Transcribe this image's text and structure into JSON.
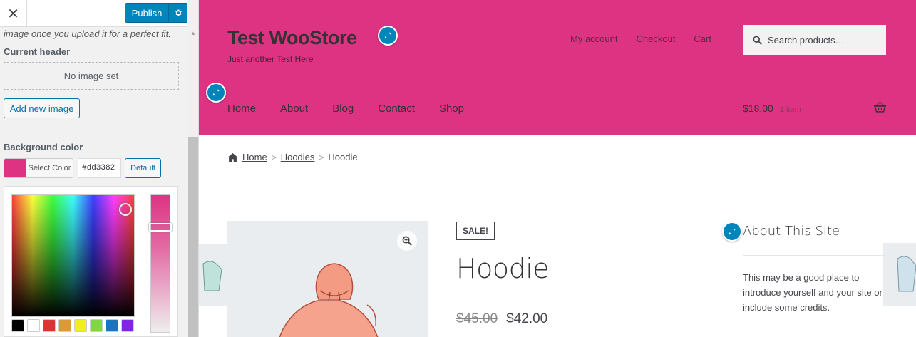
{
  "sidebar": {
    "close_label": "✕",
    "publish_label": "Publish",
    "description": "image once you upload it for a perfect fit.",
    "current_header_label": "Current header",
    "no_image_text": "No image set",
    "add_image_label": "Add new image",
    "background_color_label": "Background color",
    "select_color_label": "Select Color",
    "hex_value": "#dd3382",
    "default_label": "Default",
    "palette": [
      "#000000",
      "#ffffff",
      "#dd3333",
      "#dd9933",
      "#eeee22",
      "#81d742",
      "#1e73be",
      "#8224e3"
    ],
    "accent_color": "#0085ba"
  },
  "site": {
    "title": "Test WooStore",
    "tagline": "Just another Test Here",
    "header_color": "#dd3382",
    "top_links": [
      "My account",
      "Checkout",
      "Cart"
    ],
    "search_placeholder": "Search products…",
    "nav": [
      "Home",
      "About",
      "Blog",
      "Contact",
      "Shop"
    ],
    "cart_total": "$18.00",
    "cart_count": "1 item"
  },
  "breadcrumb": {
    "home": "Home",
    "category": "Hoodies",
    "current": "Hoodie",
    "separator": ">"
  },
  "product": {
    "badge": "SALE!",
    "title": "Hoodie",
    "old_price": "$45.00",
    "price": "$42.00"
  },
  "widget": {
    "title": "About This Site",
    "text": "This may be a good place to introduce yourself and your site or include some credits."
  }
}
